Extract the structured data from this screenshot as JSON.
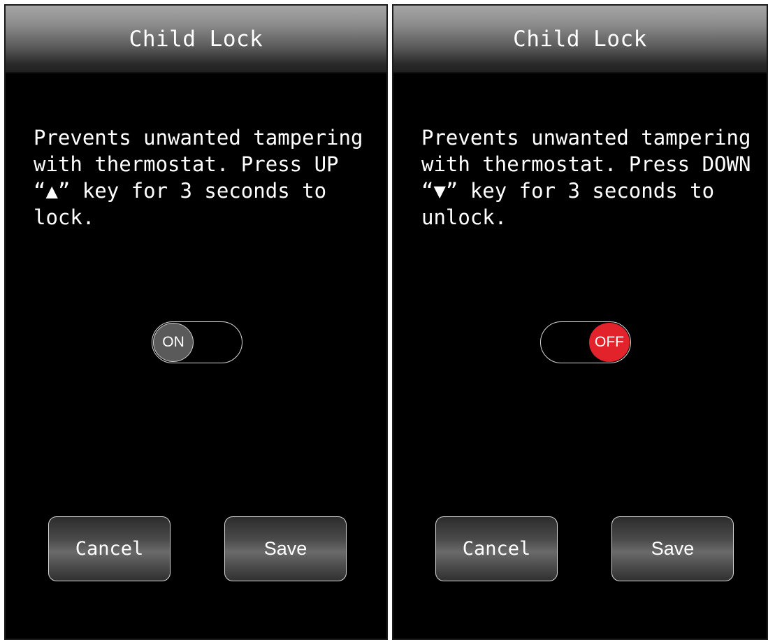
{
  "left": {
    "title": "Child Lock",
    "description": [
      "Prevents unwanted tampering",
      "with thermostat. Press UP",
      "“▲” key for 3 seconds to",
      "lock."
    ],
    "toggle": {
      "label": "ON",
      "state": "on",
      "color": "#5a5a5a"
    },
    "cancel_label": "Cancel",
    "save_label": "Save"
  },
  "right": {
    "title": "Child Lock",
    "description": [
      "Prevents unwanted tampering",
      "with thermostat. Press DOWN",
      "“▼” key for 3 seconds to",
      "unlock."
    ],
    "toggle": {
      "label": "OFF",
      "state": "off",
      "color": "#e3232c"
    },
    "cancel_label": "Cancel",
    "save_label": "Save"
  }
}
